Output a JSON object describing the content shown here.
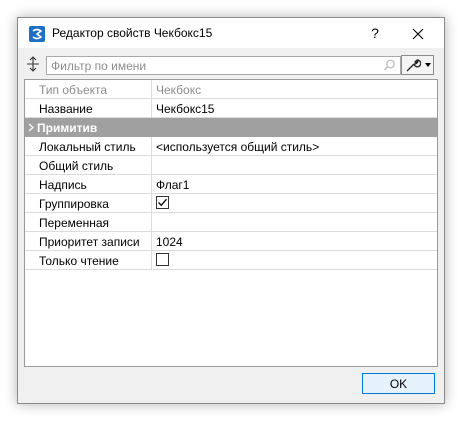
{
  "window": {
    "title": "Редактор свойств Чекбокс15",
    "help_label": "?",
    "close_label": "✕"
  },
  "filter": {
    "placeholder": "Фильтр по имени",
    "value": ""
  },
  "properties": [
    {
      "key": "Тип объекта",
      "value": "Чекбокс",
      "muted": true
    },
    {
      "key": "Название",
      "value": "Чекбокс15"
    },
    {
      "key": "Примитив",
      "group": true
    },
    {
      "key": "Локальный стиль",
      "value": "<используется общий стиль>"
    },
    {
      "key": "Общий стиль",
      "value": ""
    },
    {
      "key": "Надпись",
      "value": "Флаг1"
    },
    {
      "key": "Группировка",
      "checkbox": true,
      "checked": true
    },
    {
      "key": "Переменная",
      "value": ""
    },
    {
      "key": "Приоритет записи",
      "value": "1024"
    },
    {
      "key": "Только чтение",
      "checkbox": true,
      "checked": false
    }
  ],
  "buttons": {
    "ok_label": "OK"
  },
  "icons": {
    "app": "app-logo-icon",
    "sort": "sort-updown-icon",
    "search": "search-icon",
    "settings": "wrench-icon",
    "dropdown": "chevron-down-icon",
    "group_expand": "chevron-right-icon",
    "check": "check-icon"
  },
  "colors": {
    "accent": "#0078d7",
    "group_header_bg": "#a0a0a0",
    "muted_text": "#8d8d8d",
    "dialog_bg": "#f0f0f0"
  }
}
